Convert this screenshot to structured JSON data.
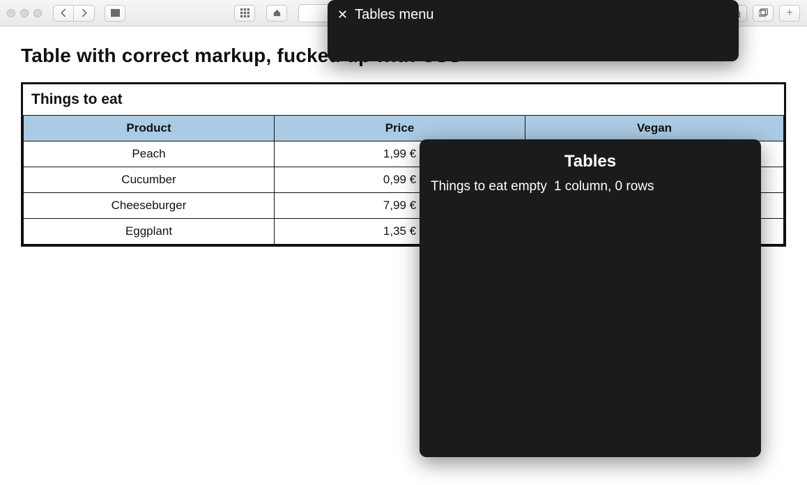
{
  "toolbar": {
    "plus_glyph": "+"
  },
  "page": {
    "title": "Table with correct markup, fucked up with CSS",
    "caption": "Things to eat",
    "columns": {
      "product": "Product",
      "price": "Price",
      "vegan": "Vegan"
    },
    "rows": [
      {
        "product": "Peach",
        "price": "1,99 €",
        "vegan": ""
      },
      {
        "product": "Cucumber",
        "price": "0,99 €",
        "vegan": ""
      },
      {
        "product": "Cheeseburger",
        "price": "7,99 €",
        "vegan": ""
      },
      {
        "product": "Eggplant",
        "price": "1,35 €",
        "vegan": ""
      }
    ]
  },
  "voiceover_top": {
    "close_glyph": "✕",
    "label": "Tables menu"
  },
  "voiceover_rotor": {
    "heading": "Tables",
    "line_left": "Things to eat empty",
    "line_right": "1 column, 0 rows"
  }
}
